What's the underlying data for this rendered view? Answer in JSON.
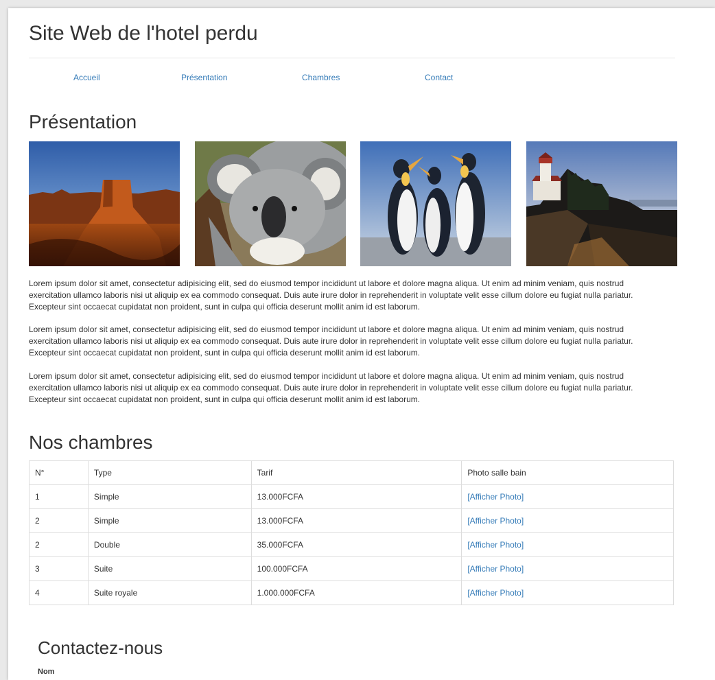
{
  "site": {
    "title": "Site Web de l'hotel perdu"
  },
  "nav": {
    "items": [
      "Accueil",
      "Présentation",
      "Chambres",
      "Contact"
    ]
  },
  "presentation": {
    "heading": "Présentation",
    "images": [
      "desert-mesa-photo",
      "koala-photo",
      "penguins-photo",
      "lighthouse-photo"
    ],
    "paragraphs": [
      "Lorem ipsum dolor sit amet, consectetur adipisicing elit, sed do eiusmod tempor incididunt ut labore et dolore magna aliqua. Ut enim ad minim veniam, quis nostrud exercitation ullamco laboris nisi ut aliquip ex ea commodo consequat. Duis aute irure dolor in reprehenderit in voluptate velit esse cillum dolore eu fugiat nulla pariatur. Excepteur sint occaecat cupidatat non proident, sunt in culpa qui officia deserunt mollit anim id est laborum.",
      "Lorem ipsum dolor sit amet, consectetur adipisicing elit, sed do eiusmod tempor incididunt ut labore et dolore magna aliqua. Ut enim ad minim veniam, quis nostrud exercitation ullamco laboris nisi ut aliquip ex ea commodo consequat. Duis aute irure dolor in reprehenderit in voluptate velit esse cillum dolore eu fugiat nulla pariatur. Excepteur sint occaecat cupidatat non proident, sunt in culpa qui officia deserunt mollit anim id est laborum.",
      "Lorem ipsum dolor sit amet, consectetur adipisicing elit, sed do eiusmod tempor incididunt ut labore et dolore magna aliqua. Ut enim ad minim veniam, quis nostrud exercitation ullamco laboris nisi ut aliquip ex ea commodo consequat. Duis aute irure dolor in reprehenderit in voluptate velit esse cillum dolore eu fugiat nulla pariatur. Excepteur sint occaecat cupidatat non proident, sunt in culpa qui officia deserunt mollit anim id est laborum."
    ]
  },
  "rooms": {
    "heading": "Nos chambres",
    "columns": [
      "N°",
      "Type",
      "Tarif",
      "Photo salle bain"
    ],
    "rows": [
      {
        "num": "1",
        "type": "Simple",
        "price": "13.000FCFA",
        "link": "[Afficher Photo]"
      },
      {
        "num": "2",
        "type": "Simple",
        "price": "13.000FCFA",
        "link": "[Afficher Photo]"
      },
      {
        "num": "2",
        "type": "Double",
        "price": "35.000FCFA",
        "link": "[Afficher Photo]"
      },
      {
        "num": "3",
        "type": "Suite",
        "price": "100.000FCFA",
        "link": "[Afficher Photo]"
      },
      {
        "num": "4",
        "type": "Suite royale",
        "price": "1.000.000FCFA",
        "link": "[Afficher Photo]"
      }
    ]
  },
  "contact": {
    "heading": "Contactez-nous",
    "name_label": "Nom"
  },
  "colors": {
    "link": "#337ab7",
    "text": "#333333",
    "border": "#dddddd"
  }
}
